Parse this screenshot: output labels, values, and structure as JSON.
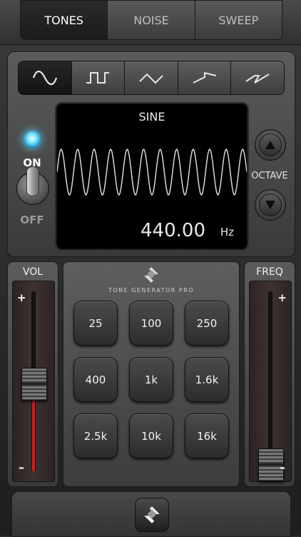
{
  "tabs": [
    {
      "label": "TONES",
      "active": true
    },
    {
      "label": "NOISE",
      "active": false
    },
    {
      "label": "SWEEP",
      "active": false
    }
  ],
  "waveforms": [
    {
      "icon": "sine-wave-icon",
      "active": true
    },
    {
      "icon": "square-wave-icon",
      "active": false
    },
    {
      "icon": "triangle-wave-icon",
      "active": false
    },
    {
      "icon": "sawtooth-wave-icon",
      "active": false
    },
    {
      "icon": "reverse-sawtooth-wave-icon",
      "active": false
    }
  ],
  "display": {
    "wave_name": "SINE",
    "frequency": "440.00",
    "unit": "Hz"
  },
  "power": {
    "on_label": "ON",
    "off_label": "OFF",
    "state": "on"
  },
  "octave": {
    "label": "OCTAVE"
  },
  "volume": {
    "title": "VOL",
    "plus": "+",
    "minus": "–",
    "level": 0.49
  },
  "freq_slider": {
    "title": "FREQ",
    "plus": "+",
    "minus": "–",
    "level": 0.04
  },
  "brand": "TONE GENERATOR PRO",
  "presets": [
    "25",
    "100",
    "250",
    "400",
    "1k",
    "1.6k",
    "2.5k",
    "10k",
    "16k"
  ],
  "colors": {
    "led": "#5fd3ff",
    "level_fill": "#e01818"
  }
}
